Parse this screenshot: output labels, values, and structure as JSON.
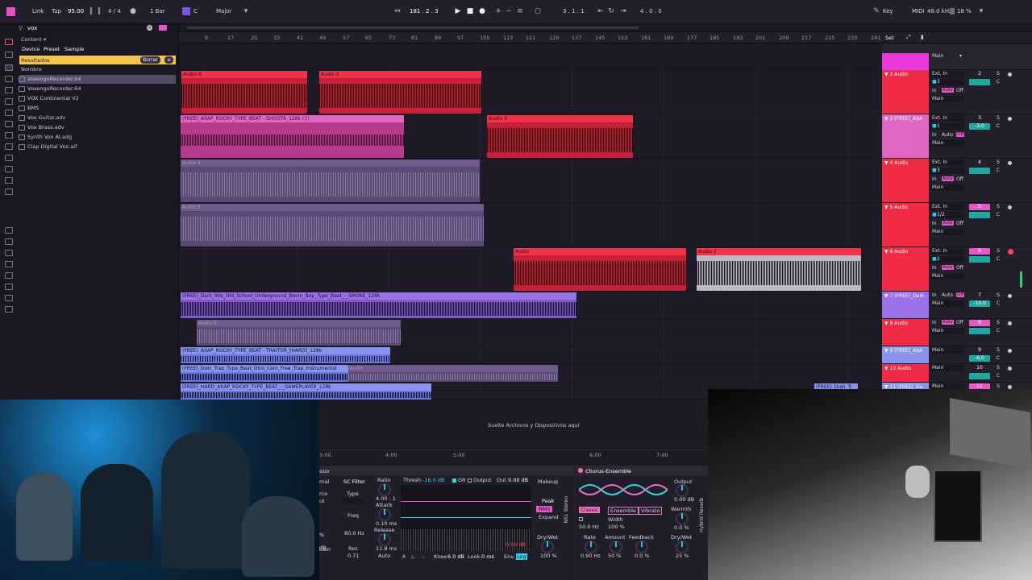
{
  "topbar": {
    "link": "Link",
    "tap": "Tap",
    "tempo": "95.00",
    "signature": "4 / 4",
    "quantize": "1 Bar",
    "key": "C",
    "scale": "Major",
    "position": "181 .   2 .   3",
    "loop_start": "3 .   1 .   1",
    "loop_length": "4 .   0 .   0",
    "key_label": "Key",
    "midi_label": "MIDI",
    "sample_rate": "48.0 kHz",
    "cpu": "18 %"
  },
  "browser": {
    "search_value": "vox",
    "content_label": "Content",
    "filters": [
      "Device",
      "Preset",
      "Sample"
    ],
    "results_label": "Resultados",
    "clear_label": "Borrar",
    "name_header": "Nombre",
    "items": [
      "VoxengoRecorder.64",
      "VoxengoRecorder.64",
      "VOX Continental V2",
      "BMS",
      "Vox Guitar.adv",
      "Vox Brass.adv",
      "Synth Vox AI.adg",
      "Clap Digital Vox.aif"
    ]
  },
  "ruler": {
    "ticks": [
      "9",
      "17",
      "25",
      "33",
      "41",
      "49",
      "57",
      "65",
      "73",
      "81",
      "89",
      "97",
      "105",
      "113",
      "121",
      "129",
      "137",
      "145",
      "153",
      "161",
      "169",
      "177",
      "185",
      "193",
      "201",
      "209",
      "217",
      "225",
      "233",
      "241"
    ],
    "set_label": "Set",
    "time_ticks": [
      "3:00",
      "4:00",
      "5:00",
      "6:00",
      "7:00"
    ]
  },
  "clips": {
    "t2a": "Audio 6",
    "t2b": "Audio 5",
    "t3a": "(FREE)_ASAP_ROCKY_TYPE_BEAT - SHOOTA_128k (1)",
    "t3b": "Audio 3",
    "t4a": "Audio 4",
    "t5a": "Audio 5",
    "t6a": "Audio",
    "t6b": "Audio 2",
    "t7a": "(FREE)_Dark_90s_Old_School_Underground_Boom_Bap_Type_Beat_-_SMOKE_128k",
    "t8a": "Audio 6",
    "t9a": "(FREE)_ASAP_ROCKY_TYPE_BEAT - TRAITOR_[HARD]_128k",
    "t10a": "(FREE)_Duki_Trap_Type_Beat_Otro_Cero_Free_Trap_Instrumental",
    "t10b": "Audio",
    "t11a": "(FREE)_HARD_ASAP_ROCKY_TYPE_BEAT_-_GAMEPLAYER_128k",
    "t11b": "(FREE)_Duki_Tr"
  },
  "tracks": [
    {
      "name": "",
      "route": "Main",
      "color": "#e83ad8"
    },
    {
      "name": "2 Audio",
      "input": "Ext. In",
      "channel": "3",
      "num": "2",
      "color": "#ef2b46"
    },
    {
      "name": "3 [FREE]_ASA",
      "input": "Ext. In",
      "channel": "1",
      "num": "3",
      "vol": "-3.0",
      "color": "#e066c6"
    },
    {
      "name": "4 Audio",
      "input": "Ext. In",
      "channel": "3",
      "num": "4",
      "color": "#ef2b46"
    },
    {
      "name": "5 Audio",
      "input": "Ext. In",
      "channel": "1/2",
      "num": "5",
      "color": "#ef2b46"
    },
    {
      "name": "6 Audio",
      "input": "Ext. In",
      "channel": "2",
      "num": "6",
      "color": "#ef2b46"
    },
    {
      "name": "7 (FREE)_Dark",
      "num": "7",
      "vol": "-10.0",
      "color": "#9a71e8"
    },
    {
      "name": "8 Audio",
      "num": "8",
      "color": "#ef2b46"
    },
    {
      "name": "9 [FREE]_ASA",
      "num": "9",
      "vol": "-6.0",
      "color": "#8a93ee"
    },
    {
      "name": "10 Audio",
      "num": "10",
      "color": "#ef2b46"
    },
    {
      "name": "11 (FREE)_Du",
      "num": "11",
      "color": "#8a93ee"
    }
  ],
  "track_labels": {
    "in": "In",
    "auto": "Auto",
    "off": "Off",
    "main": "Main",
    "s": "S",
    "c": "C"
  },
  "drop_hint": "Suelte Archivos y Dispositivos aquí",
  "compressor": {
    "partial_title": "ssor",
    "partial_rnal": "rnal",
    "partial_rce": "rce",
    "partial_ut": "ut",
    "partial_dain": "dain",
    "partial_b": "dB",
    "partial_percent": "%",
    "sc_filter": "SC Filter",
    "type": "Type",
    "freq": "Freq",
    "freq_val": "80.0 Hz",
    "res": "Res",
    "res_val": "0.71",
    "ratio": "Ratio",
    "ratio_val": "4.00 : 1",
    "attack": "Attack",
    "attack_val": "0.10 ms",
    "release": "Release",
    "release_val": "11.8 ms",
    "auto": "Auto",
    "thresh": "Thresh",
    "thresh_val": "-16.0 dB",
    "gr": "GR",
    "output": "Output",
    "out": "Out",
    "out_val": "0.00 dB",
    "makeup": "Makeup",
    "peak": "Peak",
    "rms": "RMS",
    "expand": "Expand",
    "drywet": "Dry/Wet",
    "drywet_val": "100 %",
    "knee": "Knee",
    "knee_val": "6.0 dB",
    "look": "Look.",
    "look_val": "0 ms",
    "env": "Env.",
    "env_val": "Log",
    "meter_val": "0.00 dB",
    "ns1": "NS1 Stereo"
  },
  "chorus": {
    "title": "Chorus-Ensemble",
    "output": "Output",
    "output_val": "0.00 dB",
    "classic": "Classic",
    "ensemble": "Ensemble",
    "vibrato": "Vibrato",
    "warmth": "Warmth",
    "warmth_val": "0.0 %",
    "width": "Width",
    "width_val": "100 %",
    "freq_val": "50.0 Hz",
    "rate": "Rate",
    "rate_val": "0.90 Hz",
    "amount": "Amount",
    "amount_val": "50 %",
    "feedback": "Feedback",
    "feedback_val": "0.0 %",
    "drywet": "Dry/Wet",
    "drywet_val": "25 %",
    "next": "Hybrid Reverb"
  }
}
